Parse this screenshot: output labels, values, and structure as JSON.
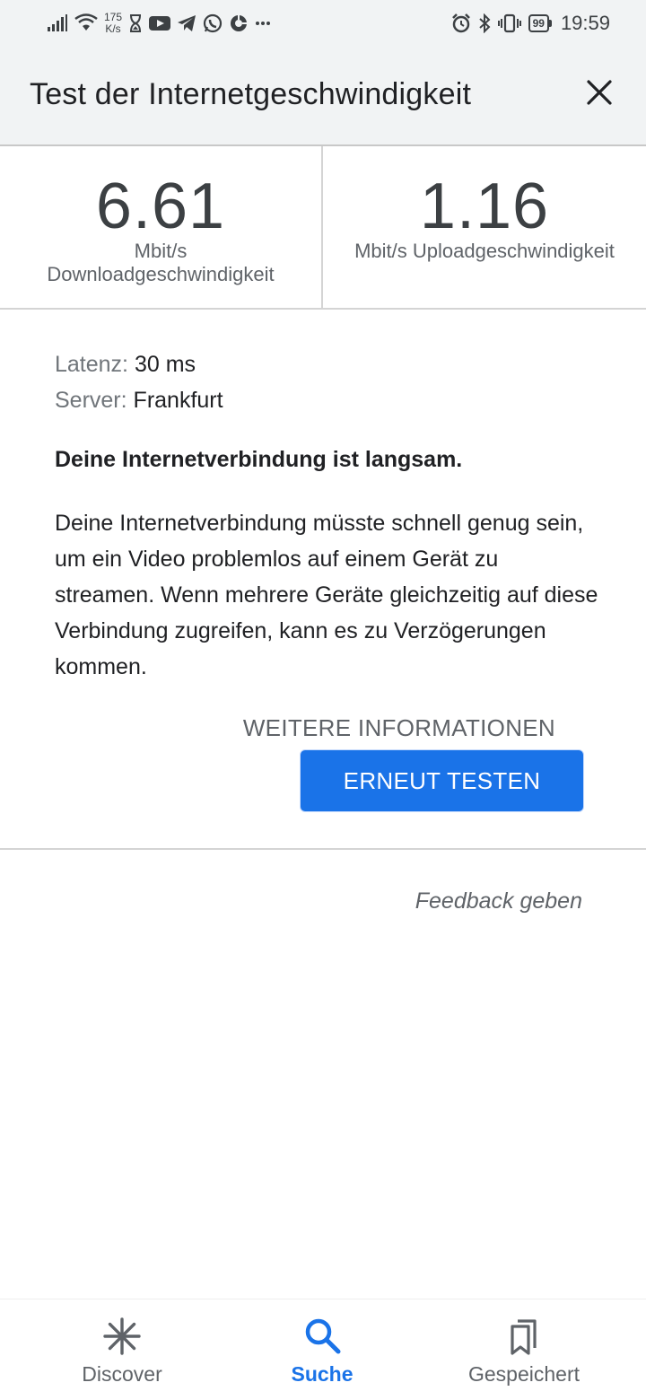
{
  "status_bar": {
    "speed_value": "175",
    "speed_unit": "K/s",
    "battery": "99",
    "time": "19:59",
    "left_icons": [
      "signal-icon",
      "wifi-icon",
      "hourglass-icon",
      "youtube-icon",
      "telegram-icon",
      "whatsapp-icon",
      "app-icon",
      "more-icon"
    ],
    "right_icons": [
      "alarm-icon",
      "bluetooth-icon",
      "vibrate-icon",
      "battery-icon"
    ]
  },
  "header": {
    "title": "Test der Internetgeschwindigkeit",
    "close_icon": "close-icon"
  },
  "results": {
    "download": {
      "value": "6.61",
      "unit_line1": "Mbit/s",
      "unit_line2": "Downloadgeschwindigkeit"
    },
    "upload": {
      "value": "1.16",
      "unit": "Mbit/s Uploadgeschwindigkeit"
    }
  },
  "details": {
    "latency_label": "Latenz:",
    "latency_value": "30 ms",
    "server_label": "Server:",
    "server_value": "Frankfurt",
    "verdict": "Deine Internetverbindung ist langsam.",
    "description": "Deine Internetverbindung müsste schnell genug sein, um ein Video problemlos auf einem Gerät zu streamen. Wenn mehrere Geräte gleichzeitig auf diese Verbindung zugreifen, kann es zu Verzögerungen kommen.",
    "more_info_label": "WEITERE INFORMATIONEN",
    "retest_label": "ERNEUT TESTEN"
  },
  "feedback_label": "Feedback geben",
  "bottom_nav": {
    "items": [
      {
        "label": "Discover",
        "icon": "asterisk-icon",
        "active": false
      },
      {
        "label": "Suche",
        "icon": "search-icon",
        "active": true
      },
      {
        "label": "Gespeichert",
        "icon": "bookmarks-icon",
        "active": false
      }
    ]
  },
  "colors": {
    "accent": "#1a73e8",
    "header_bg": "#f1f3f4",
    "text_primary": "#202124",
    "text_secondary": "#5f6368"
  }
}
